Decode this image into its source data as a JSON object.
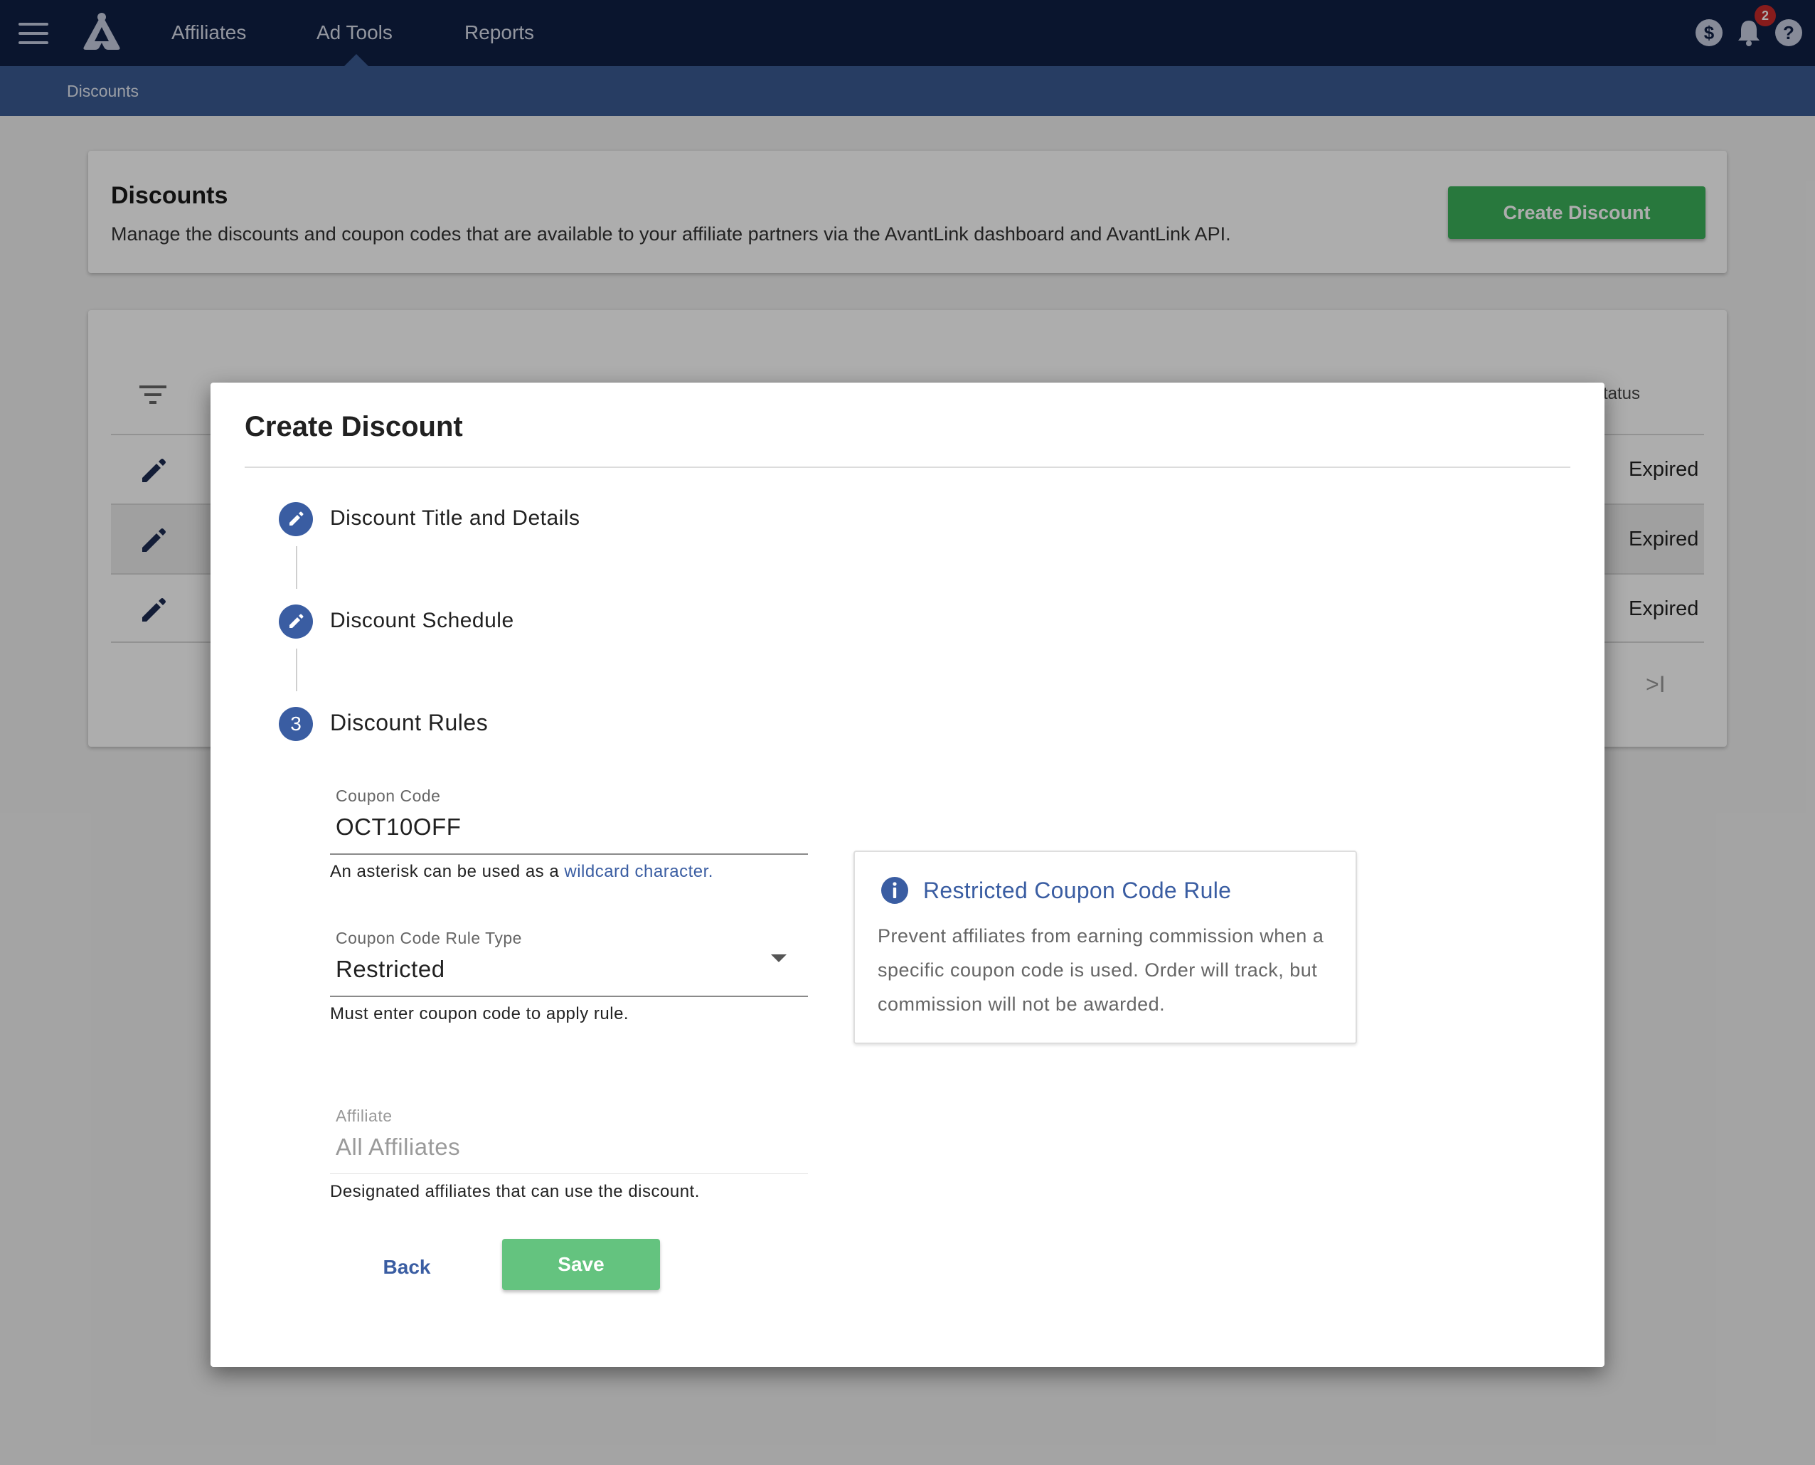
{
  "nav": {
    "items": [
      {
        "label": "Affiliates"
      },
      {
        "label": "Ad Tools"
      },
      {
        "label": "Reports"
      }
    ],
    "active": "Ad Tools",
    "notification_count": "2",
    "icons": [
      "menu-icon",
      "logo",
      "dollar-icon",
      "bell-icon",
      "help-icon"
    ]
  },
  "breadcrumb": "Discounts",
  "page": {
    "title": "Discounts",
    "description": "Manage the discounts and coupon codes that are available to your affiliate partners via the AvantLink dashboard and AvantLink API.",
    "create_button": "Create Discount"
  },
  "table": {
    "status_header": "tatus",
    "rows": [
      {
        "status": "Expired"
      },
      {
        "status": "Expired"
      },
      {
        "status": "Expired"
      }
    ],
    "pager_last": ">I"
  },
  "modal": {
    "title": "Create Discount",
    "steps": [
      {
        "marker": "pencil",
        "label": "Discount Title and Details"
      },
      {
        "marker": "pencil",
        "label": "Discount Schedule"
      },
      {
        "marker": "3",
        "label": "Discount Rules"
      }
    ],
    "coupon_code": {
      "label": "Coupon Code",
      "value": "OCT10OFF",
      "help_prefix": "An asterisk can be used as a ",
      "help_link": "wildcard character."
    },
    "rule_type": {
      "label": "Coupon Code Rule Type",
      "value": "Restricted",
      "help": "Must enter coupon code to apply rule."
    },
    "affiliate": {
      "label": "Affiliate",
      "placeholder": "All Affiliates",
      "help": "Designated affiliates that can use the discount."
    },
    "info": {
      "title": "Restricted Coupon Code Rule",
      "body": "Prevent affiliates from earning commission when a specific coupon code is used. Order will track, but commission will not be awarded."
    },
    "back_label": "Back",
    "save_label": "Save"
  },
  "colors": {
    "nav_bg": "#0f1f45",
    "subnav_bg": "#3a5a93",
    "accent_blue": "#3a5da2",
    "green": "#3cb15a",
    "status_expired": "#222222"
  }
}
